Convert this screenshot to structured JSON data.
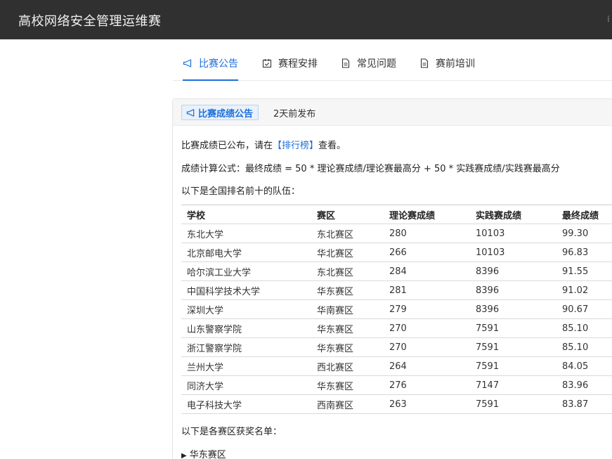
{
  "header": {
    "title": "高校网络安全管理运维赛",
    "menu_icon": "grip-icon"
  },
  "tabs": [
    {
      "label": "比赛公告",
      "icon": "megaphone-icon",
      "active": true
    },
    {
      "label": "赛程安排",
      "icon": "calendar-check-icon",
      "active": false
    },
    {
      "label": "常见问题",
      "icon": "document-icon",
      "active": false
    },
    {
      "label": "赛前培训",
      "icon": "document-icon",
      "active": false
    }
  ],
  "announcement": {
    "badge": "比赛成绩公告",
    "posted": "2天前发布",
    "line1_before": "比赛成绩已公布，请在",
    "line1_link": "【排行榜】",
    "line1_after": "查看。",
    "formula": "成绩计算公式：最终成绩 = 50 * 理论赛成绩/理论赛最高分 + 50 * 实践赛成绩/实践赛最高分",
    "top10_intro": "以下是全国排名前十的队伍：",
    "awards_intro": "以下是各赛区获奖名单：",
    "region_section": "华东赛区"
  },
  "table": {
    "headers": [
      "学校",
      "赛区",
      "理论赛成绩",
      "实践赛成绩",
      "最终成绩"
    ],
    "rows": [
      [
        "东北大学",
        "东北赛区",
        "280",
        "10103",
        "99.30"
      ],
      [
        "北京邮电大学",
        "华北赛区",
        "266",
        "10103",
        "96.83"
      ],
      [
        "哈尔滨工业大学",
        "东北赛区",
        "284",
        "8396",
        "91.55"
      ],
      [
        "中国科学技术大学",
        "华东赛区",
        "281",
        "8396",
        "91.02"
      ],
      [
        "深圳大学",
        "华南赛区",
        "279",
        "8396",
        "90.67"
      ],
      [
        "山东警察学院",
        "华东赛区",
        "270",
        "7591",
        "85.10"
      ],
      [
        "浙江警察学院",
        "华东赛区",
        "270",
        "7591",
        "85.10"
      ],
      [
        "兰州大学",
        "西北赛区",
        "264",
        "7591",
        "84.05"
      ],
      [
        "同济大学",
        "华东赛区",
        "276",
        "7147",
        "83.96"
      ],
      [
        "电子科技大学",
        "西南赛区",
        "263",
        "7591",
        "83.87"
      ]
    ]
  }
}
